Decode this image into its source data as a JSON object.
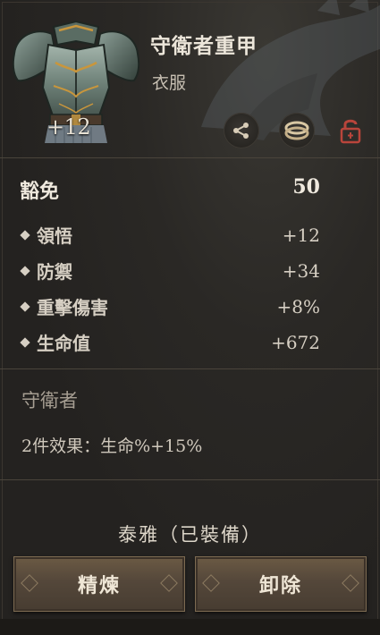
{
  "item": {
    "name": "守衛者重甲",
    "type": "衣服",
    "enhancement": "+12",
    "icons": [
      "share-icon",
      "ring-compare-icon",
      "unlock-icon"
    ]
  },
  "stats": {
    "main": {
      "label": "豁免",
      "value": "50"
    },
    "sub": [
      {
        "label": "領悟",
        "value": "+12"
      },
      {
        "label": "防禦",
        "value": "+34"
      },
      {
        "label": "重擊傷害",
        "value": "+8%"
      },
      {
        "label": "生命值",
        "value": "+672"
      }
    ]
  },
  "set": {
    "title": "守衛者",
    "effect": "2件效果：生命%+15%"
  },
  "equipped_by": "泰雅（已裝備）",
  "buttons": {
    "refine": "精煉",
    "unequip": "卸除"
  },
  "colors": {
    "panel_bg": "#242220",
    "button_bg": "#54473a",
    "lock_red": "#b9453b"
  }
}
